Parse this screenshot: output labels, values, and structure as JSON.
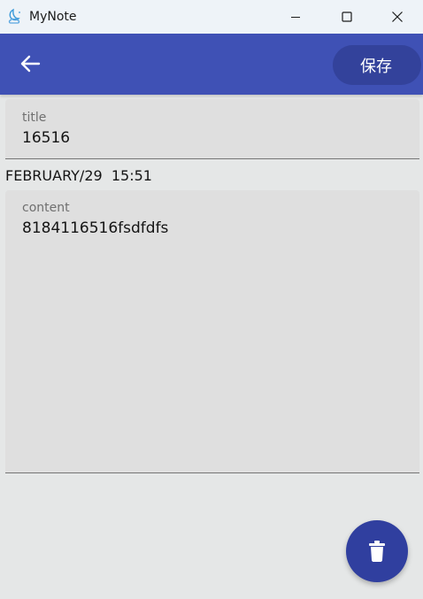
{
  "window": {
    "title": "MyNote",
    "icon": "moon-cloud-icon"
  },
  "appbar": {
    "back_icon": "arrow-left-icon",
    "save_label": "保存",
    "color": "#3f51b5"
  },
  "title_field": {
    "label": "title",
    "value": "16516"
  },
  "date_text": "FEBRUARY/29  15:51",
  "content_field": {
    "label": "content",
    "value": "8184116516fsdfdfs"
  },
  "fab": {
    "icon": "trash-icon",
    "color": "#303f9f"
  }
}
